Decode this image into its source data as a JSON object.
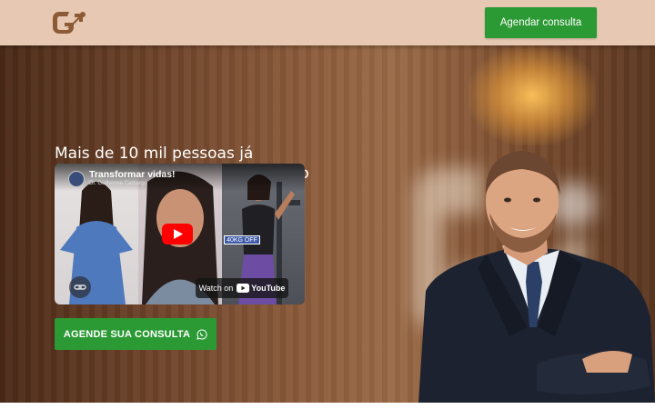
{
  "header": {
    "logo_icon": "ngc-logo-icon",
    "cta_label": "Agendar consulta"
  },
  "hero": {
    "headline": "Mais de 10 mil pessoas já transformaram suas vidas com o método NGC",
    "video": {
      "title": "Transformar vidas!",
      "channel": "Dr. Guilherme Camargo",
      "tag": "40KG OFF",
      "watch_on": "Watch on",
      "youtube_label": "YouTube"
    },
    "cta_label": "AGENDE SUA CONSULTA",
    "cta_icon": "whatsapp-icon"
  },
  "colors": {
    "header_bg": "#e7c8b2",
    "button_green": "#2c9a34",
    "logo_brown": "#8c5a35"
  }
}
